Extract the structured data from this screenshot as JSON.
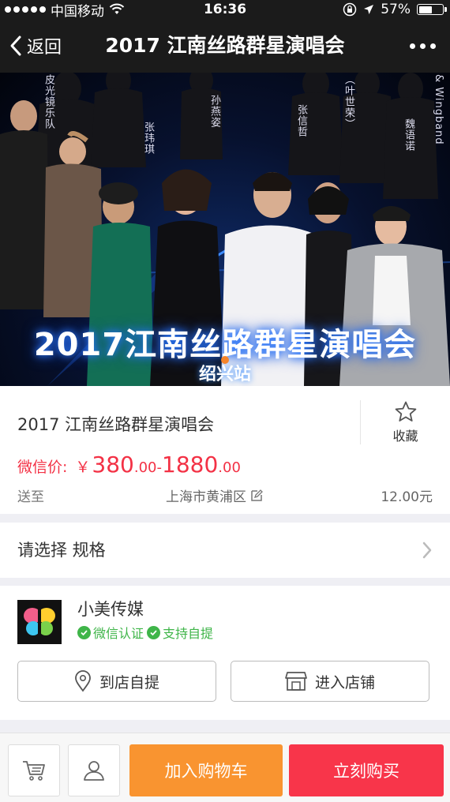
{
  "status_bar": {
    "carrier": "中国移动",
    "time": "16:36",
    "battery": "57%",
    "battery_level": 0.57
  },
  "nav": {
    "back_label": "返回",
    "title": "2017 江南丝路群星演唱会"
  },
  "banner": {
    "headline": "2017江南丝路群星演唱会",
    "station": "绍兴站",
    "name_tags": [
      "皮光镜乐队",
      "张玮琪",
      "孙燕姿",
      "张信哲",
      "（叶世荣）",
      "魏语诺",
      "& Wingband"
    ],
    "page_index": 1,
    "page_count": 1
  },
  "product": {
    "name": "2017 江南丝路群星演唱会",
    "favorite_label": "收藏",
    "price_label": "微信价:",
    "price_currency": "￥",
    "price_min_int": "380",
    "price_min_dec": ".00",
    "price_sep": "-",
    "price_max_int": "1880",
    "price_max_dec": ".00",
    "ship_to_label": "送至",
    "address": "上海市黄浦区",
    "shipping_fee": "12.00元"
  },
  "spec": {
    "label": "请选择 规格"
  },
  "shop": {
    "name": "小美传媒",
    "badges": [
      "微信认证",
      "支持自提"
    ],
    "pickup_label": "到店自提",
    "enter_label": "进入店铺"
  },
  "bottom_bar": {
    "add_to_cart": "加入购物车",
    "buy_now": "立刻购买"
  },
  "colors": {
    "price": "#f33145",
    "add_to_cart": "#f99430",
    "buy_now": "#f8354a",
    "verified": "#3fb549",
    "pager_active": "#f5842a"
  }
}
